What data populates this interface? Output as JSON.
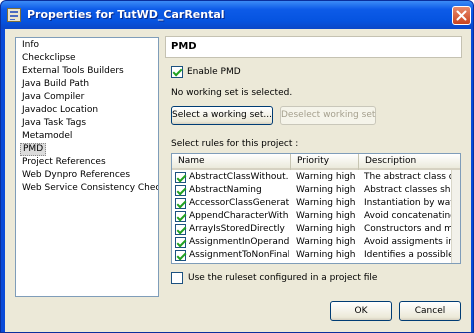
{
  "window": {
    "title": "Properties for TutWD_CarRental",
    "close_glyph": "✕"
  },
  "nav": {
    "items": [
      {
        "label": "Info",
        "selected": false
      },
      {
        "label": "Checkclipse",
        "selected": false
      },
      {
        "label": "External Tools Builders",
        "selected": false
      },
      {
        "label": "Java Build Path",
        "selected": false
      },
      {
        "label": "Java Compiler",
        "selected": false
      },
      {
        "label": "Javadoc Location",
        "selected": false
      },
      {
        "label": "Java Task Tags",
        "selected": false
      },
      {
        "label": "Metamodel",
        "selected": false
      },
      {
        "label": "PMD",
        "selected": true
      },
      {
        "label": "Project References",
        "selected": false
      },
      {
        "label": "Web Dynpro References",
        "selected": false
      },
      {
        "label": "Web Service Consistency Chec",
        "selected": false
      }
    ]
  },
  "page": {
    "title": "PMD",
    "enable_label": "Enable PMD",
    "enable_checked": true,
    "no_working_set_text": "No working set is selected.",
    "select_working_set_button": "Select a working set...",
    "deselect_working_set_button": "Deselect working set",
    "select_rules_label": "Select rules for this project :",
    "use_ruleset_label": "Use the ruleset configured in a project file",
    "use_ruleset_checked": false
  },
  "rules_table": {
    "columns": [
      "Name",
      "Priority",
      "Description"
    ],
    "rows": [
      {
        "checked": true,
        "name": "AbstractClassWithout...",
        "priority": "Warning high",
        "description": "The abstract class d"
      },
      {
        "checked": true,
        "name": "AbstractNaming",
        "priority": "Warning high",
        "description": "Abstract classes sho"
      },
      {
        "checked": true,
        "name": "AccessorClassGenerat...",
        "priority": "Warning high",
        "description": "Instantiation by way"
      },
      {
        "checked": true,
        "name": "AppendCharacterWith...",
        "priority": "Warning high",
        "description": "Avoid concatenating"
      },
      {
        "checked": true,
        "name": "ArrayIsStoredDirectly",
        "priority": "Warning high",
        "description": "Constructors and me"
      },
      {
        "checked": true,
        "name": "AssignmentInOperand",
        "priority": "Warning high",
        "description": "Avoid assigments in"
      },
      {
        "checked": true,
        "name": "AssignmentToNonFinal...",
        "priority": "Warning high",
        "description": "Identifies a possible"
      }
    ]
  },
  "footer": {
    "ok_button": "OK",
    "cancel_button": "Cancel"
  }
}
